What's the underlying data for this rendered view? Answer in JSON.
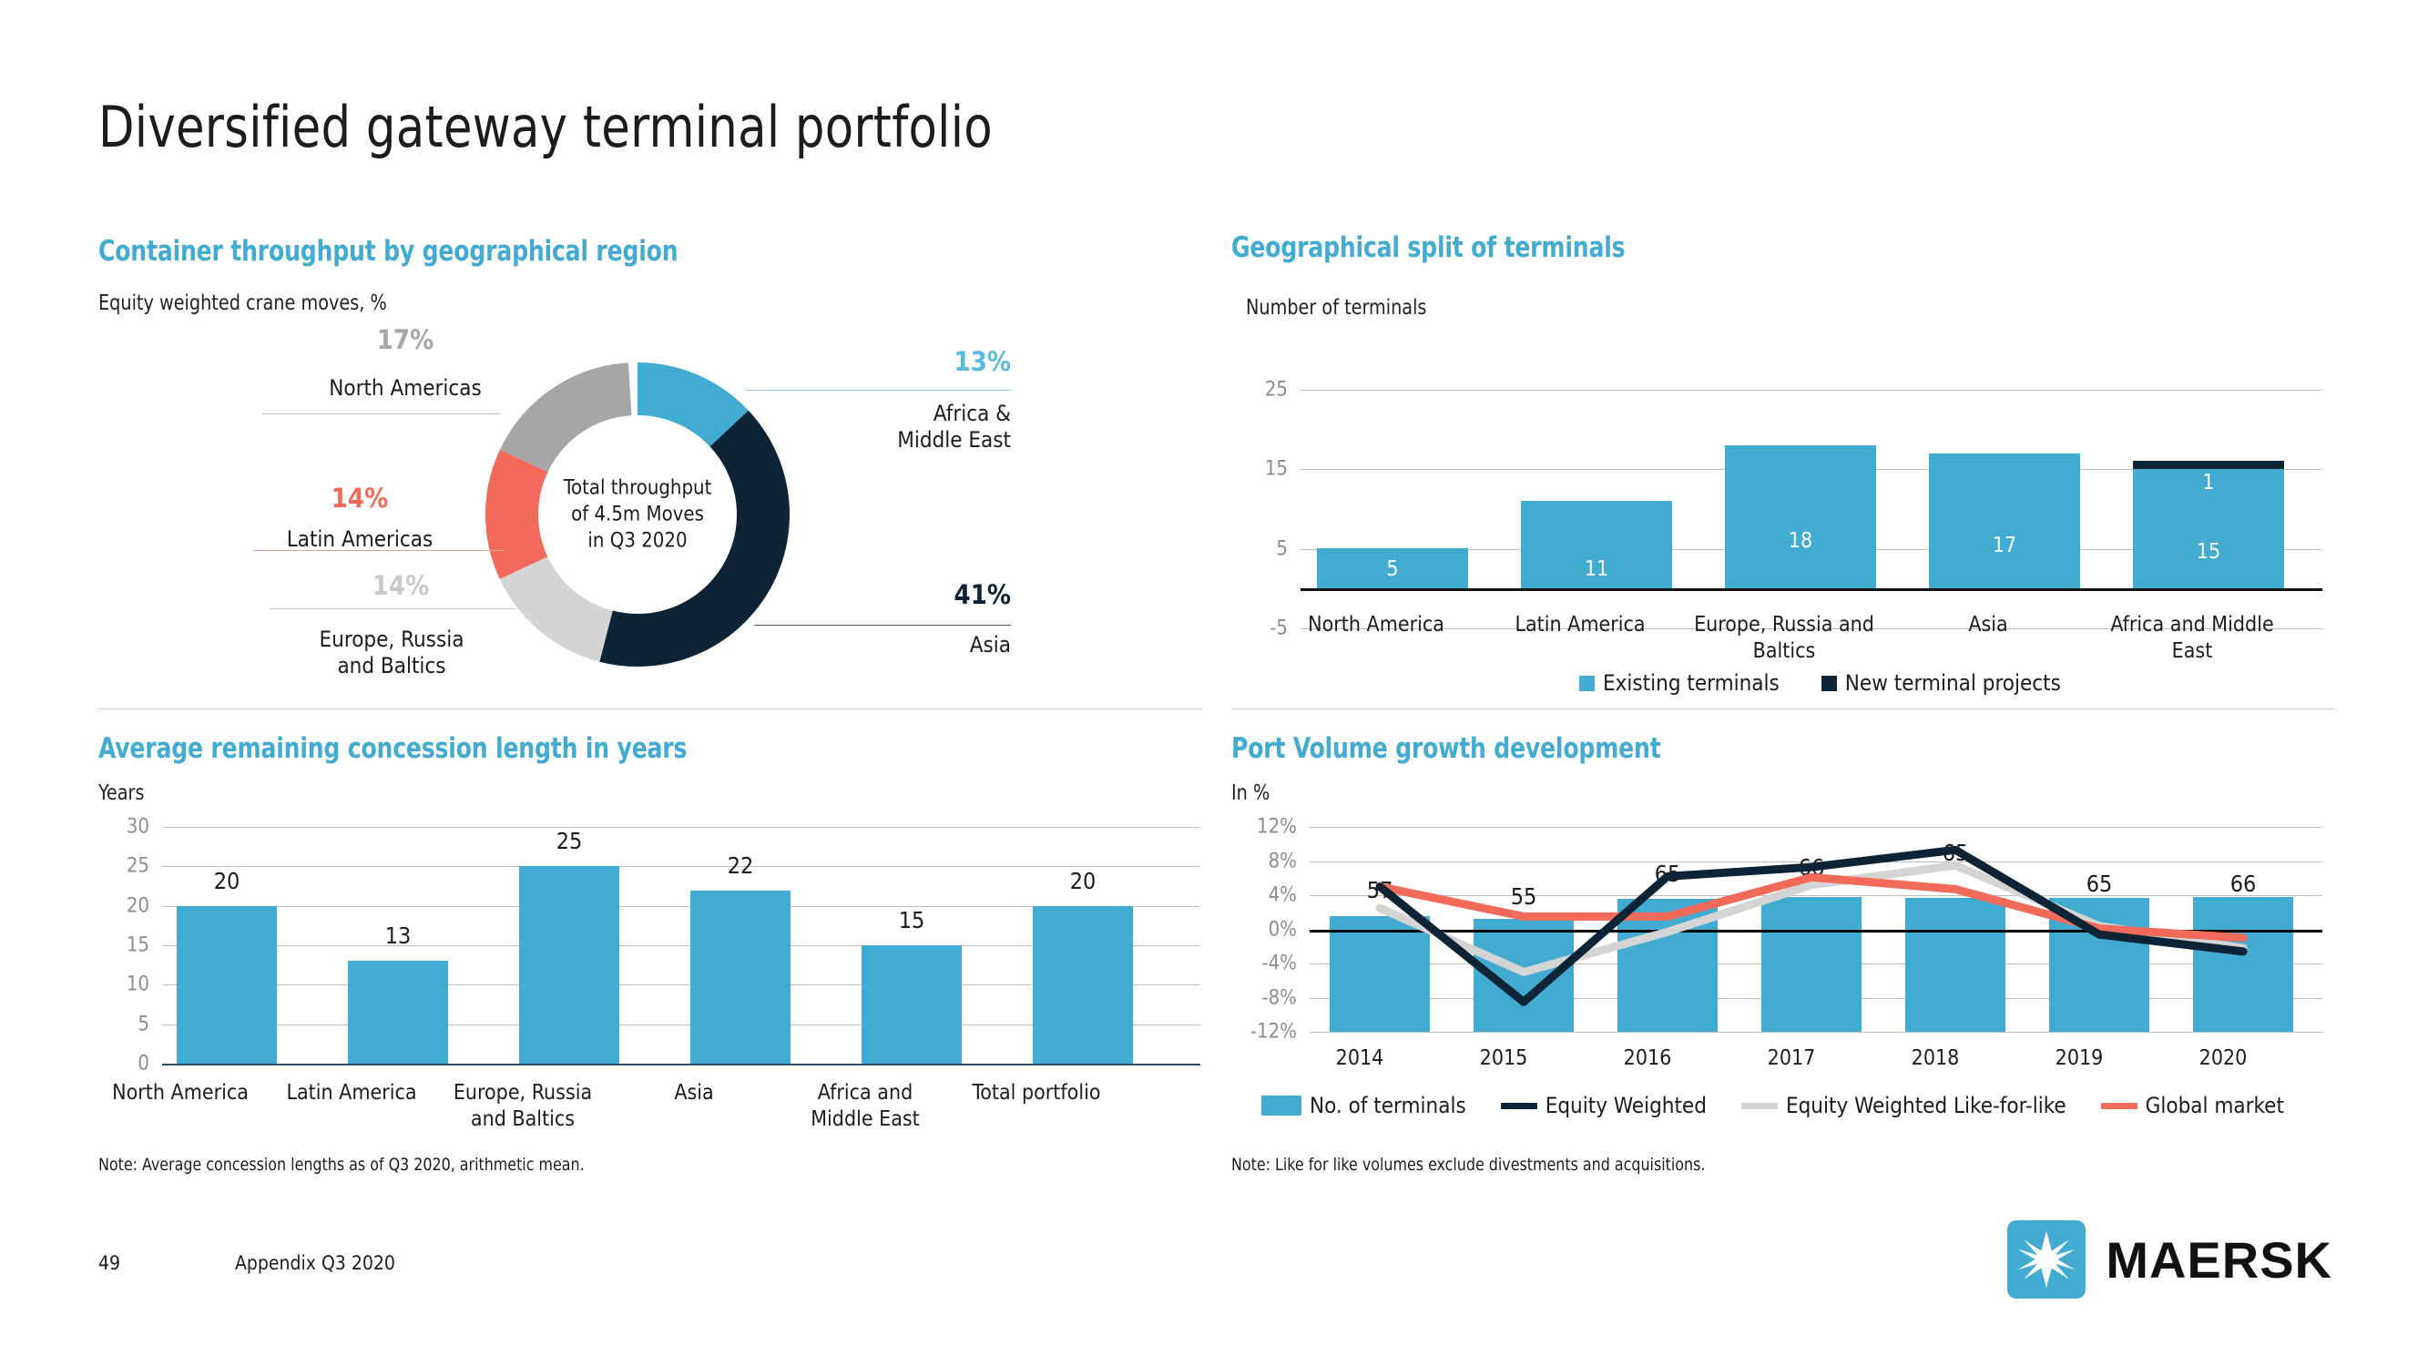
{
  "slide": {
    "title": "Diversified gateway terminal portfolio",
    "page_number": "49",
    "appendix": "Appendix Q3 2020",
    "brand": "MAERSK"
  },
  "colors": {
    "accent_blue": "#42ABD1",
    "navy": "#0d2436",
    "red": "#F26A5A",
    "gray_mid": "#A6A6A6",
    "gray_light": "#D4D4D4"
  },
  "donut_panel": {
    "title": "Container throughput by geographical region",
    "subtitle": "Equity weighted crane moves, %",
    "center_line1": "Total throughput",
    "center_line2": "of 4.5m Moves",
    "center_line3": "in Q3 2020"
  },
  "terminals_panel": {
    "title": "Geographical split of terminals",
    "subtitle": "Number of terminals"
  },
  "concession_panel": {
    "title": "Average remaining concession length in years",
    "subtitle": "Years",
    "note": "Note: Average concession lengths as of Q3 2020, arithmetic mean."
  },
  "volume_panel": {
    "title": "Port Volume growth development",
    "subtitle": "In %",
    "note": "Note: Like for like volumes exclude divestments and acquisitions."
  },
  "chart_data": [
    {
      "type": "pie",
      "title": "Container throughput by geographical region",
      "subtitle": "Equity weighted crane moves, %",
      "center_text": "Total throughput of 4.5m Moves in Q3 2020",
      "unit": "%",
      "slices": [
        {
          "label": "Africa & Middle East",
          "label_line1": "Africa &",
          "label_line2": "Middle East",
          "value": 13,
          "display": "13%",
          "color": "#42ABD1"
        },
        {
          "label": "Asia",
          "label_line1": "Asia",
          "label_line2": "",
          "value": 41,
          "display": "41%",
          "color": "#0d2436"
        },
        {
          "label": "Europe, Russia and Baltics",
          "label_line1": "Europe, Russia",
          "label_line2": "and Baltics",
          "value": 14,
          "display": "14%",
          "color": "#D4D4D4"
        },
        {
          "label": "Latin Americas",
          "label_line1": "Latin Americas",
          "label_line2": "",
          "value": 14,
          "display": "14%",
          "color": "#F26A5A"
        },
        {
          "label": "North Americas",
          "label_line1": "North Americas",
          "label_line2": "",
          "value": 17,
          "display": "17%",
          "color": "#A6A6A6"
        }
      ]
    },
    {
      "type": "bar",
      "title": "Geographical split of terminals",
      "subtitle": "Number of terminals",
      "xlabel": "",
      "ylabel": "Number of terminals",
      "ylim": [
        -5,
        25
      ],
      "yticks": [
        -5,
        5,
        15,
        25
      ],
      "ytick_labels": [
        "-5",
        "5",
        "15",
        "25"
      ],
      "grid": true,
      "stacked": true,
      "legend_position": "bottom",
      "categories": [
        "North America",
        "Latin America",
        "Europe, Russia and Baltics",
        "Asia",
        "Africa and Middle East"
      ],
      "category_lines": [
        [
          "North America",
          ""
        ],
        [
          "Latin America",
          ""
        ],
        [
          "Europe, Russia and",
          "Baltics"
        ],
        [
          "Asia",
          ""
        ],
        [
          "Africa and Middle",
          "East"
        ]
      ],
      "series": [
        {
          "name": "Existing terminals",
          "color": "#42ABD1",
          "values": [
            5,
            11,
            18,
            17,
            15
          ],
          "labels": [
            "5",
            "11",
            "18",
            "17",
            "15"
          ]
        },
        {
          "name": "New terminal projects",
          "color": "#0d2436",
          "values": [
            0,
            0,
            0,
            0,
            1
          ],
          "labels": [
            "",
            "",
            "",
            "",
            "1"
          ]
        }
      ]
    },
    {
      "type": "bar",
      "title": "Average remaining concession length in years",
      "subtitle": "Years",
      "xlabel": "",
      "ylabel": "Years",
      "ylim": [
        0,
        30
      ],
      "yticks": [
        0,
        5,
        10,
        15,
        20,
        25,
        30
      ],
      "ytick_labels": [
        "0",
        "5",
        "10",
        "15",
        "20",
        "25",
        "30"
      ],
      "grid": true,
      "categories": [
        "North America",
        "Latin America",
        "Europe, Russia and Baltics",
        "Asia",
        "Africa and Middle East",
        "Total portfolio"
      ],
      "category_lines": [
        [
          "North America",
          ""
        ],
        [
          "Latin America",
          ""
        ],
        [
          "Europe, Russia",
          "and Baltics"
        ],
        [
          "Asia",
          ""
        ],
        [
          "Africa and",
          "Middle East"
        ],
        [
          "Total portfolio",
          ""
        ]
      ],
      "values": [
        20,
        13,
        25,
        22,
        15,
        20
      ],
      "value_labels": [
        "20",
        "13",
        "25",
        "22",
        "15",
        "20"
      ],
      "color": "#42ABD1"
    },
    {
      "type": "line",
      "title": "Port Volume growth development",
      "subtitle": "In %",
      "xlabel": "",
      "ylabel": "In %",
      "ylim": [
        -12,
        12
      ],
      "yticks": [
        -12,
        -8,
        -4,
        0,
        4,
        8,
        12
      ],
      "ytick_labels": [
        "-12%",
        "-8%",
        "-4%",
        "0%",
        "4%",
        "8%",
        "12%"
      ],
      "grid": true,
      "legend_position": "bottom",
      "x": [
        "2014",
        "2015",
        "2016",
        "2017",
        "2018",
        "2019",
        "2020"
      ],
      "bar_series": {
        "name": "No. of terminals",
        "color": "#42ABD1",
        "values": [
          57,
          55,
          65,
          66,
          65,
          65,
          66
        ],
        "value_labels": [
          "57",
          "55",
          "65",
          "66",
          "65",
          "65",
          "66"
        ],
        "plotted_percent": [
          1.6,
          1.2,
          3.6,
          3.8,
          3.7,
          3.7,
          3.8
        ]
      },
      "series": [
        {
          "name": "Equity Weighted",
          "color": "#0d2436",
          "values": [
            5.0,
            -8.5,
            6.2,
            7.3,
            9.3,
            -0.6,
            -2.6
          ]
        },
        {
          "name": "Equity Weighted Like-for-like",
          "color": "#D4D4D4",
          "values": [
            2.5,
            -5.0,
            -0.3,
            5.2,
            7.5,
            0.4,
            -2.2
          ]
        },
        {
          "name": "Global market",
          "color": "#F26A5A",
          "values": [
            5.0,
            1.5,
            1.5,
            6.1,
            4.7,
            0.1,
            -1.0
          ]
        }
      ]
    }
  ]
}
